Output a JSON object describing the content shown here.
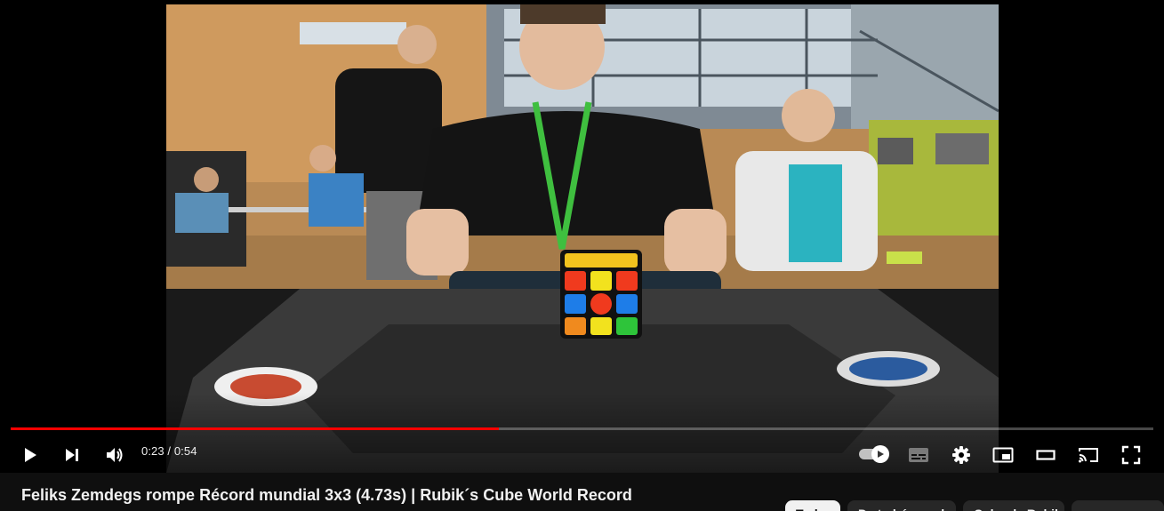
{
  "player": {
    "progress": {
      "played_fraction": 0.427,
      "loaded_fraction": 0.427
    },
    "time": {
      "current": "0:23",
      "separator": " / ",
      "duration": "0:54"
    },
    "controls": {
      "play_icon": "play-icon",
      "next_icon": "next-icon",
      "volume_icon": "volume-icon",
      "autoplay_icon": "autoplay-toggle-icon",
      "subtitles_icon": "subtitles-icon",
      "settings_icon": "gear-icon",
      "miniplayer_icon": "miniplayer-icon",
      "theater_icon": "theater-mode-icon",
      "cast_icon": "cast-icon",
      "fullscreen_icon": "fullscreen-icon"
    },
    "accent_color": "#ff0000"
  },
  "video": {
    "title": "Feliks Zemdegs rompe Récord mundial 3x3 (4.73s) | Rubik´s Cube World Record"
  },
  "chips": [
    {
      "label": "Todos",
      "active": true
    },
    {
      "label": "De tu búsqueda",
      "active": false
    },
    {
      "label": "Cubo de Rubik",
      "active": false
    },
    {
      "label": "",
      "active": false
    }
  ]
}
